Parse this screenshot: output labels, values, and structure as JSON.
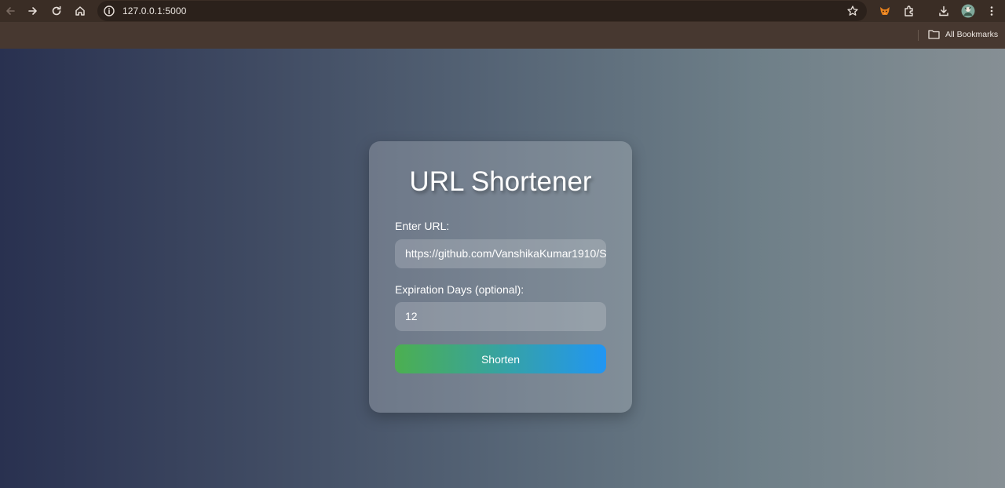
{
  "browser": {
    "url": "127.0.0.1:5000",
    "bookmarks_label": "All Bookmarks",
    "icons": {
      "back": "arrow-left-icon",
      "forward": "arrow-right-icon",
      "reload": "reload-icon",
      "home": "home-icon",
      "site_info": "info-icon",
      "bookmark": "star-icon",
      "extension_fox": "fox-extension-icon",
      "extensions": "puzzle-icon",
      "downloads": "download-icon",
      "profile": "avatar",
      "menu": "kebab-menu-icon",
      "folder": "folder-icon"
    }
  },
  "form": {
    "title": "URL Shortener",
    "url_label": "Enter URL:",
    "url_value": "https://github.com/VanshikaKumar1910/S",
    "expiration_label": "Expiration Days (optional):",
    "expiration_value": "12",
    "submit_label": "Shorten"
  },
  "colors": {
    "background_gradient": [
      "#293150",
      "#868f94"
    ],
    "button_gradient": [
      "#4caf50",
      "#2196f3"
    ],
    "toolbar": "#3a2d25",
    "bookmarks_bar": "#473830"
  }
}
